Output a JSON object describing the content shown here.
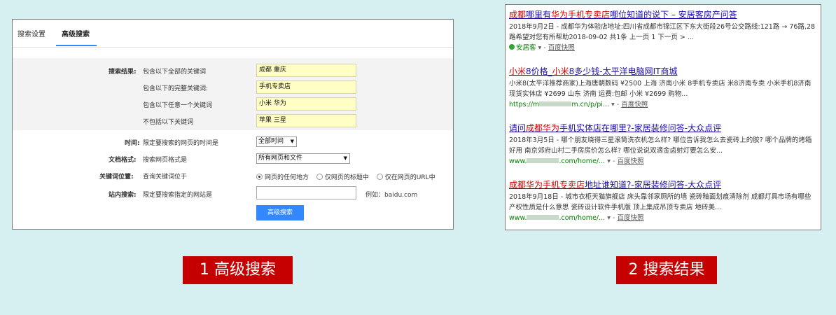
{
  "advanced": {
    "tabs": [
      "搜索设置",
      "高级搜索"
    ],
    "rows": {
      "result_label": "搜索结果:",
      "all_words": "包含以下全部的关键词",
      "all_value": "成都 重庆",
      "exact": "包含以下的完整关键词:",
      "exact_value": "手机专卖店",
      "any": "包含以下任意一个关键词",
      "any_value": "小米 华为",
      "none": "不包括以下关键词",
      "none_value": "苹果 三星",
      "time_label": "时间:",
      "time_desc": "限定要搜索的网页的时间是",
      "time_value": "全部时间",
      "format_label": "文档格式:",
      "format_desc": "搜索网页格式是",
      "format_value": "所有网页和文件",
      "position_label": "关键词位置:",
      "position_desc": "查询关键词位于",
      "position_options": [
        "网页的任何地方",
        "仅网页的标题中",
        "仅在网页的URL中"
      ],
      "site_label": "站内搜索:",
      "site_desc": "限定要搜索指定的网站是",
      "site_example": "例如：baidu.com",
      "submit": "高级搜索"
    }
  },
  "results": [
    {
      "title": [
        "成都",
        "哪里有",
        "华为",
        "手机专卖店",
        "哪位知道的说下 – 安居客房产问答"
      ],
      "abstract": "2018年9月2日 - 成都华为体验店地址:四川省成都市锦江区下东大街段26号公交路线:121路 → 76路,28路希望对您有所帮助2018-09-02 共1条 上一页 1 下一页 > ...",
      "site": "安居客",
      "snapshot": "百度快照"
    },
    {
      "title": [
        "小米",
        "8价格_",
        "小米",
        "8多少钱-太平洋电脑网IT商城"
      ],
      "abstract": "小米8(太平洋推荐商家)上海唐朝数码 ¥2500 上海 济南小米 8手机专卖店 米8济南专卖 小米手机8济南现货实体店 ¥2699 山东 济南 运费:包邮 小米 ¥2699 购物...",
      "url": "https://m",
      "url_tail": "m.cn/p/pi...",
      "snapshot": "百度快照"
    },
    {
      "title": [
        "请问",
        "成都",
        "华为",
        "手机实体店在哪里?-家居装修问答-大众点评"
      ],
      "abstract": "2018年3月5日 - 哪个朋友晓得三星滚筒洗衣机怎么样? 哪位告诉我怎么去瓷砖上的胶? 哪个品牌的烤箱好用 南京郊府山村二手房房价怎么样? 哪位说说双滴金卤射灯要怎么安...",
      "url": "www.",
      "url_tail": ".com/home/...",
      "snapshot": "百度快照"
    },
    {
      "title": [
        "成都",
        "华为",
        "手机专卖店",
        "地址谁知道?-家居装修问答-大众点评"
      ],
      "abstract": "2018年9月18日 - 城市衣柜天猫旗舰店 床头靠邻家厕所的墙 瓷砖釉面划痕清除剂 成都灯具市场有哪些 产权性质是什么意思 瓷砖设计软件手机版 顶上集成吊顶专卖店 地砖美...",
      "url": "www.",
      "url_tail": ".com/home/...",
      "snapshot": "百度快照"
    }
  ],
  "captions": [
    "1 高级搜索",
    "2 搜索结果"
  ],
  "colors": {
    "accent": "#3388ff",
    "caption_bg": "#c60000",
    "keyword_bg": "#ffffc4",
    "highlight": "#cc0000",
    "link": "#1a0dab"
  }
}
